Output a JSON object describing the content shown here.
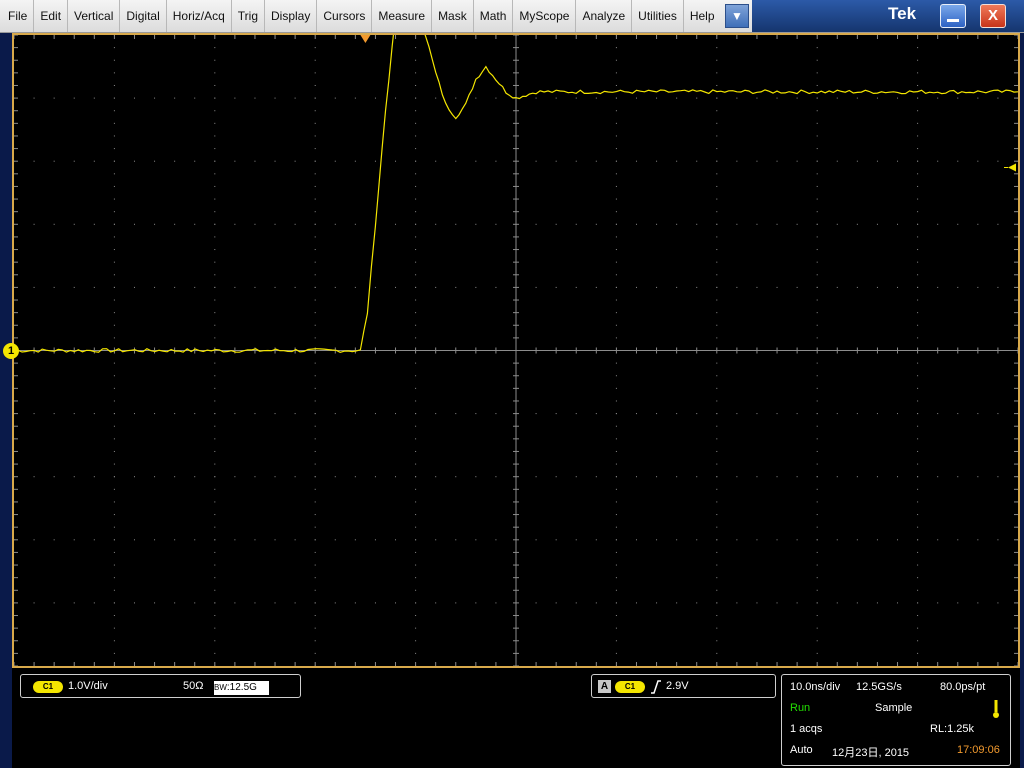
{
  "menu": {
    "items": [
      "File",
      "Edit",
      "Vertical",
      "Digital",
      "Horiz/Acq",
      "Trig",
      "Display",
      "Cursors",
      "Measure",
      "Mask",
      "Math",
      "MyScope",
      "Analyze",
      "Utilities",
      "Help"
    ]
  },
  "window": {
    "logo": "Tek",
    "minimize_icon": "minimize-icon",
    "close_label": "X"
  },
  "colors": {
    "trace": "#f4e600",
    "graticule_border": "#d8a94b",
    "grid": "#8c8c8c",
    "run_status": "#22e000",
    "time": "#f29a2e"
  },
  "channel": {
    "marker": "1",
    "badge": "C1",
    "scale": "1.0V/div",
    "impedance": "50Ω",
    "bandwidth_prefix": "BW",
    "bandwidth": ":12.5G"
  },
  "trigger": {
    "type": "A",
    "source_badge": "C1",
    "slope_icon": "rising-edge-icon",
    "level": "2.9V"
  },
  "acquisition": {
    "horizontal_scale": "10.0ns/div",
    "sample_rate": "12.5GS/s",
    "resolution": "80.0ps/pt",
    "status": "Run",
    "mode": "Sample",
    "acqs": "1 acqs",
    "record_length": "RL:1.25k",
    "trigger_mode": "Auto",
    "date": "12月23日, 2015",
    "time": "17:09:06"
  },
  "chart_data": {
    "type": "line",
    "xlabel": "",
    "ylabel": "",
    "x_divisions": 10,
    "y_divisions": 10,
    "x_scale_per_div": "10.0ns/div",
    "y_scale_per_div": "1.0V/div",
    "grid": true,
    "series": [
      {
        "x": [
          -50,
          -15.5,
          -14.8,
          -14.0,
          -13.0,
          -12.0,
          -11.2,
          -10.5,
          -10.0,
          -9.0,
          -8.0,
          -7.0,
          -6.0,
          -5.0,
          -4.0,
          -3.0,
          -2.0,
          -1.0,
          0.0,
          1.0,
          2.0,
          50
        ],
        "y": [
          0.0,
          0.0,
          0.6,
          2.0,
          3.8,
          5.3,
          5.9,
          5.75,
          5.5,
          5.0,
          4.4,
          3.9,
          3.7,
          3.9,
          4.3,
          4.5,
          4.3,
          4.1,
          4.0,
          4.05,
          4.1,
          4.1
        ]
      }
    ]
  }
}
